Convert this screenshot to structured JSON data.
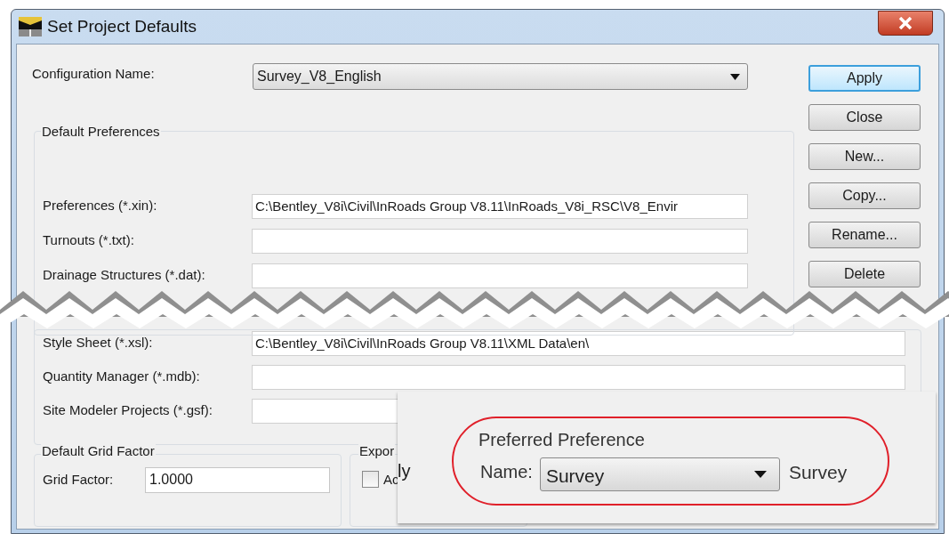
{
  "window": {
    "title": "Set Project Defaults"
  },
  "configuration": {
    "label": "Configuration Name:",
    "value": "Survey_V8_English"
  },
  "buttons": [
    {
      "label": "Apply",
      "focused": true
    },
    {
      "label": "Close",
      "focused": false
    },
    {
      "label": "New...",
      "focused": false
    },
    {
      "label": "Copy...",
      "focused": false
    },
    {
      "label": "Rename...",
      "focused": false
    },
    {
      "label": "Delete",
      "focused": false
    }
  ],
  "default_preferences": {
    "title": "Default Preferences",
    "rows_above_tear": [
      {
        "label": "Preferences (*.xin):",
        "value": "C:\\Bentley_V8i\\Civil\\InRoads Group V8.11\\InRoads_V8i_RSC\\V8_Envir"
      },
      {
        "label": "Turnouts (*.txt):"
      },
      {
        "label": "Drainage Structures (*.dat):"
      }
    ],
    "rows_below_tear": [
      {
        "label": "Style Sheet (*.xsl):",
        "value": "C:\\Bentley_V8i\\Civil\\InRoads Group V8.11\\XML Data\\en\\"
      },
      {
        "label": "Quantity Manager (*.mdb):"
      },
      {
        "label": "Site Modeler Projects (*.gsf):"
      }
    ]
  },
  "grid_factor": {
    "title": "Default Grid Factor",
    "label": "Grid Factor:",
    "value": "1.0000"
  },
  "export": {
    "title": "Expor",
    "checkbox": {
      "label": "Ac",
      "checked": false
    }
  },
  "inset": {
    "fragment": "ly",
    "preferred_preference": {
      "title": "Preferred Preference",
      "label": "Name:",
      "value": "Survey",
      "current": "Survey"
    }
  }
}
